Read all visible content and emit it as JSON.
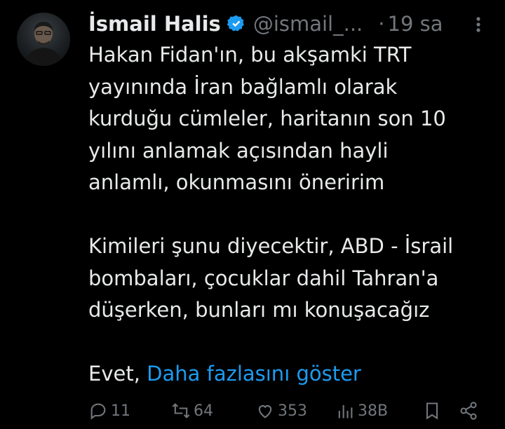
{
  "tweet": {
    "author_name": "İsmail Halis",
    "handle": "@ismail_...",
    "separator": "·",
    "time": "19 sa",
    "paragraphs": [
      [
        "Hakan Fidan'ın, bu akşamki TRT",
        "yayınında İran bağlamlı olarak",
        "kurduğu cümleler, haritanın son 10",
        "yılını anlamak açısından hayli",
        "anlamlı, okunmasını öneririm"
      ],
      [
        "Kimileri şunu diyecektir, ABD - İsrail",
        "bombaları, çocuklar dahil Tahran'a",
        "düşerken, bunları mı konuşacağız"
      ]
    ],
    "last_line_text": "Evet, ",
    "show_more": "Daha fazlasını göster"
  },
  "actions": {
    "replies": "11",
    "retweets": "64",
    "likes": "353",
    "views": "38B"
  },
  "colors": {
    "background": "#000000",
    "text": "#e7e9ea",
    "muted": "#71767b",
    "link": "#1d9bf0",
    "verified": "#1d9bf0"
  },
  "icons": [
    "verified-badge-icon",
    "more-icon",
    "reply-icon",
    "retweet-icon",
    "like-icon",
    "views-icon",
    "bookmark-icon",
    "share-icon"
  ]
}
